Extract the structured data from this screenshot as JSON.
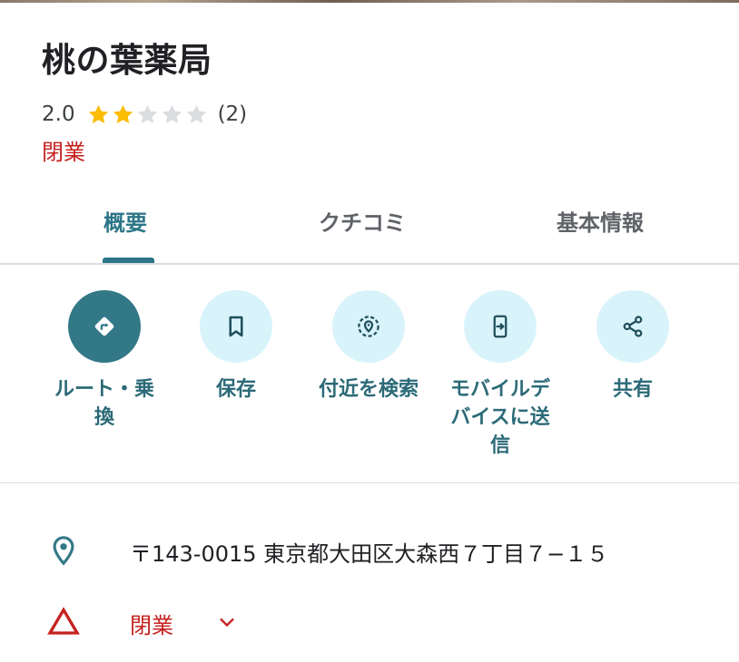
{
  "place": {
    "name": "桃の葉薬局",
    "rating": "2.0",
    "rating_value": 2,
    "rating_max": 5,
    "review_count": "(2)",
    "status": "閉業"
  },
  "tabs": [
    {
      "label": "概要",
      "active": true
    },
    {
      "label": "クチコミ",
      "active": false
    },
    {
      "label": "基本情報",
      "active": false
    }
  ],
  "actions": [
    {
      "label": "ルート・乗換",
      "icon": "directions-icon"
    },
    {
      "label": "保存",
      "icon": "bookmark-icon"
    },
    {
      "label": "付近を検索",
      "icon": "nearby-search-icon"
    },
    {
      "label": "モバイルデバイスに送信",
      "icon": "send-to-phone-icon"
    },
    {
      "label": "共有",
      "icon": "share-icon"
    }
  ],
  "details": {
    "address": "〒143-0015 東京都大田区大森西７丁目７−１５",
    "hours_status": "閉業"
  },
  "colors": {
    "accent": "#2c7688",
    "closed": "#c5221f",
    "star_filled": "#fbbc04",
    "star_empty": "#dadce0",
    "action_bg": "#d9f3fb",
    "primary_action_bg": "#337886"
  }
}
